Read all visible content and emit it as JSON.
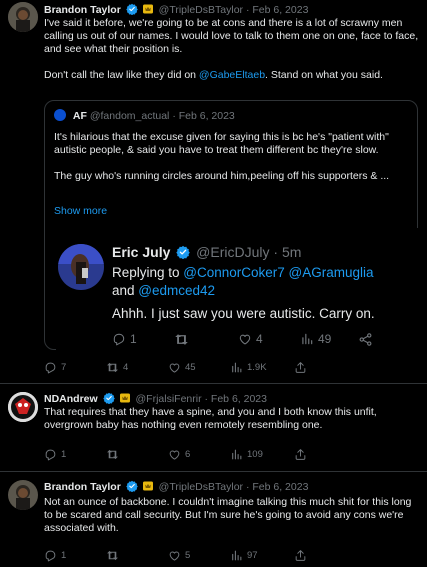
{
  "tweet1": {
    "name": "Brandon Taylor",
    "handle": "@TripleDsBTaylor",
    "date": "· Feb 6, 2023",
    "text_part1": "I've said it before, we're going to be at cons and there is a lot of scrawny men calling us out of our names. I would love to talk to them one on one, face to face, and see what their position is.\n\nDon't call the law like they did on ",
    "mention": "@GabeEltaeb",
    "text_part2": ". Stand on what you said.",
    "stats": {
      "replies": "7",
      "retweets": "4",
      "likes": "45",
      "views": "1.9K"
    }
  },
  "quote": {
    "badge": "AF",
    "handle": "@fandom_actual",
    "date": "· Feb 6, 2023",
    "text": "It's hilarious that the excuse given for saying this is bc he's \"patient with\" autistic people, & said you have to treat them different bc they're slow.\n\nThe guy who's running circles around him,peeling off his supporters & ...",
    "show_more": "Show more"
  },
  "embedded": {
    "name": "Eric July",
    "handle": "@EricDJuly",
    "time": "· 5m",
    "replying_label": "Replying to ",
    "reply_mentions": "@ConnorCoker7 @AGramuglia",
    "reply_and": "and ",
    "reply_last": "@edmced42",
    "text": "Ahhh. I just saw you were autistic. Carry on.",
    "stats": {
      "replies": "1",
      "likes": "4",
      "views": "49"
    }
  },
  "tweet2": {
    "name": "NDAndrew",
    "handle": "@FrjalsiFenrir",
    "date": "· Feb 6, 2023",
    "text": "That requires that they have a spine, and you and I both know this unfit, overgrown baby has nothing even remotely resembling one.",
    "stats": {
      "replies": "1",
      "likes": "6",
      "views": "109"
    }
  },
  "tweet3": {
    "name": "Brandon Taylor",
    "handle": "@TripleDsBTaylor",
    "date": "· Feb 6, 2023",
    "text": "Not an ounce of backbone. I couldn't imagine talking this much shit for this long to be scared and call security. But I'm sure he's going to avoid any cons we're associated with.",
    "stats": {
      "replies": "1",
      "likes": "5",
      "views": "97"
    }
  },
  "colors": {
    "accent": "#1d9bf0",
    "muted": "#71767b",
    "gold": "#e8b80f",
    "border": "#2f3336"
  }
}
